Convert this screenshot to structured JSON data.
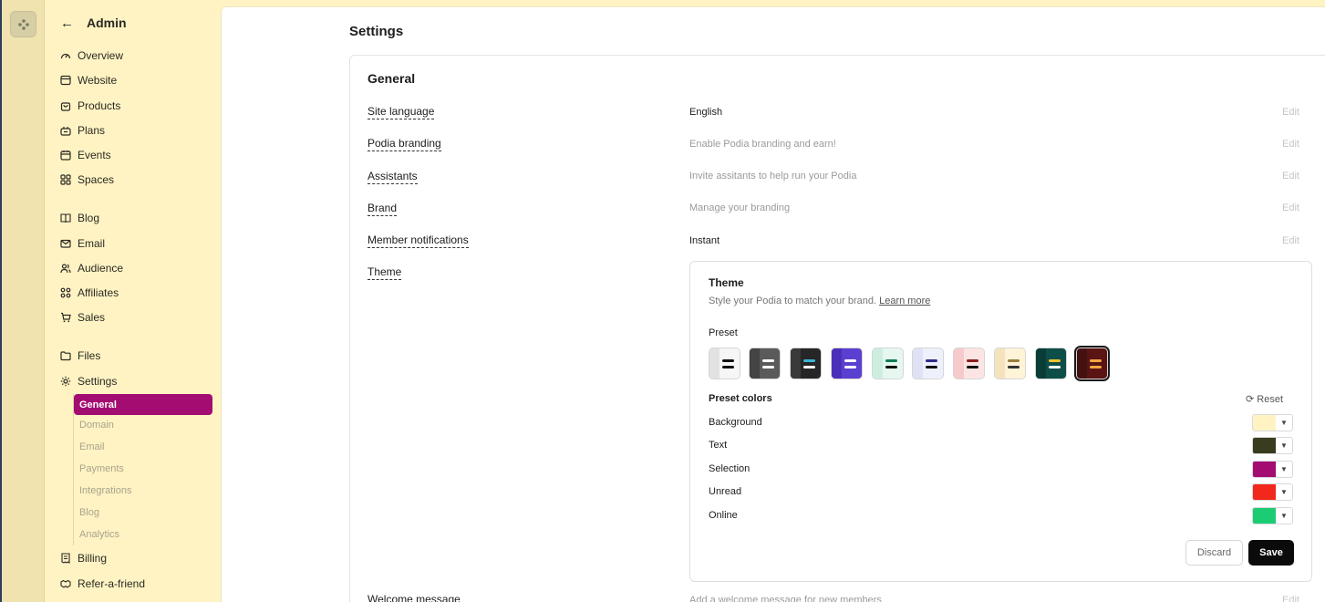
{
  "sidebar": {
    "title": "Admin",
    "back_icon": "←",
    "nav": [
      {
        "label": "Overview"
      },
      {
        "label": "Website"
      },
      {
        "label": "Products"
      },
      {
        "label": "Plans"
      },
      {
        "label": "Events"
      },
      {
        "label": "Spaces"
      },
      {
        "label": "Blog"
      },
      {
        "label": "Email"
      },
      {
        "label": "Audience"
      },
      {
        "label": "Affiliates"
      },
      {
        "label": "Sales"
      },
      {
        "label": "Files"
      },
      {
        "label": "Settings"
      },
      {
        "label": "Billing"
      },
      {
        "label": "Refer-a-friend"
      }
    ],
    "settings_sub": [
      {
        "label": "General"
      },
      {
        "label": "Domain"
      },
      {
        "label": "Email"
      },
      {
        "label": "Payments"
      },
      {
        "label": "Integrations"
      },
      {
        "label": "Blog"
      },
      {
        "label": "Analytics"
      }
    ]
  },
  "main": {
    "page_title": "Settings",
    "card_title": "General",
    "edit_label": "Edit",
    "rows": [
      {
        "label": "Site language",
        "value": "English"
      },
      {
        "label": "Podia branding",
        "value": "Enable Podia branding and earn!"
      },
      {
        "label": "Assistants",
        "value": "Invite assitants to help run your Podia"
      },
      {
        "label": "Brand",
        "value": "Manage your branding"
      },
      {
        "label": "Member notifications",
        "value": "Instant"
      },
      {
        "label": "Theme",
        "value": ""
      },
      {
        "label": "Welcome message",
        "value": "Add a welcome message for new members"
      }
    ],
    "theme": {
      "title": "Theme",
      "subtitle": "Style your Podia to match your brand.",
      "learn_more": "Learn more",
      "preset_label": "Preset",
      "preset_colors_label": "Preset colors",
      "reset_label": "⟳ Reset",
      "colors": [
        {
          "label": "Background",
          "hex": "#fff3c4"
        },
        {
          "label": "Text",
          "hex": "#393c1e"
        },
        {
          "label": "Selection",
          "hex": "#a30d72"
        },
        {
          "label": "Unread",
          "hex": "#f2281c"
        },
        {
          "label": "Online",
          "hex": "#1ccc74"
        }
      ],
      "presets": [
        {
          "bg": "#f6f6f6",
          "side": "#e2e2e2",
          "bar1": "#111111",
          "bar2": "#111111"
        },
        {
          "bg": "#5a5a5a",
          "side": "#444444",
          "bar1": "#ffffff",
          "bar2": "#ffffff"
        },
        {
          "bg": "#262626",
          "side": "#3a3a3a",
          "bar1": "#3bb4d6",
          "bar2": "#ffffff"
        },
        {
          "bg": "#5b3fd1",
          "side": "#4a30b8",
          "bar1": "#ffffff",
          "bar2": "#ffffff"
        },
        {
          "bg": "#e6f7ef",
          "side": "#cdeede",
          "bar1": "#0d7b55",
          "bar2": "#111111"
        },
        {
          "bg": "#eef0fb",
          "side": "#dfe2f5",
          "bar1": "#2f2a8c",
          "bar2": "#111111"
        },
        {
          "bg": "#fde4e4",
          "side": "#f6caca",
          "bar1": "#8c1b1b",
          "bar2": "#111111"
        },
        {
          "bg": "#fff3d8",
          "side": "#f3e3bd",
          "bar1": "#9b7d3a",
          "bar2": "#333333"
        },
        {
          "bg": "#0d4e48",
          "side": "#0a3d38",
          "bar1": "#f2c230",
          "bar2": "#ffffff"
        },
        {
          "bg": "#5a1414",
          "side": "#441010",
          "bar1": "#f4a640",
          "bar2": "#f4a640"
        }
      ],
      "discard_label": "Discard",
      "save_label": "Save"
    }
  }
}
